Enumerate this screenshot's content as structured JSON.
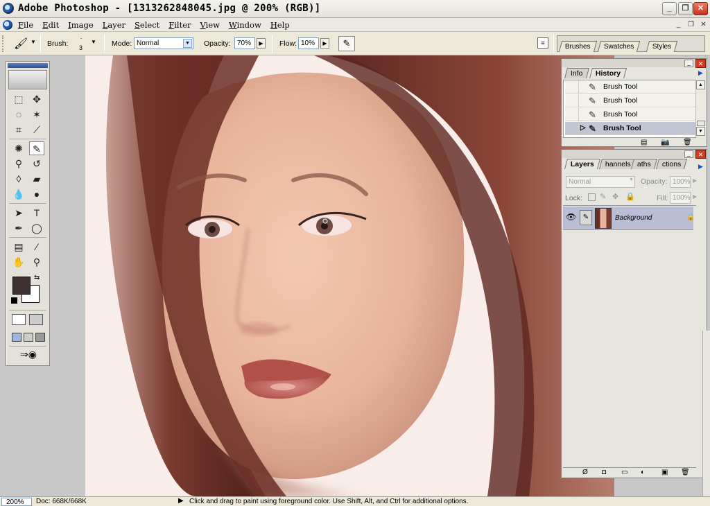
{
  "window": {
    "title": "Adobe Photoshop - [1313262848045.jpg @ 200% (RGB)]",
    "controls": {
      "minimize": "_",
      "maximize": "❐",
      "close": "✕"
    }
  },
  "menu": [
    "File",
    "Edit",
    "Image",
    "Layer",
    "Select",
    "Filter",
    "View",
    "Window",
    "Help"
  ],
  "options_bar": {
    "brush_label": "Brush:",
    "brush_size": "3",
    "mode_label": "Mode:",
    "mode_value": "Normal",
    "opacity_label": "Opacity:",
    "opacity_value": "70%",
    "flow_label": "Flow:",
    "flow_value": "10%"
  },
  "palette_well": {
    "tabs": [
      "Brushes",
      "Swatches",
      "Styles"
    ]
  },
  "history_panel": {
    "tabs": [
      "Info",
      "History"
    ],
    "active_tab": "History",
    "items": [
      {
        "label": "Brush Tool"
      },
      {
        "label": "Brush Tool"
      },
      {
        "label": "Brush Tool"
      },
      {
        "label": "Brush Tool",
        "current": true
      }
    ]
  },
  "layers_panel": {
    "tabs": [
      "Layers",
      "Channels",
      "Paths",
      "Actions"
    ],
    "tab_display": [
      "Layers",
      "hannels",
      "aths",
      "ctions"
    ],
    "active_tab": "Layers",
    "blend_mode": "Normal",
    "opacity_label": "Opacity:",
    "opacity_value": "100%",
    "lock_label": "Lock:",
    "fill_label": "Fill:",
    "fill_value": "100%",
    "layers": [
      {
        "name": "Background",
        "visible": true,
        "locked": true
      }
    ]
  },
  "colors": {
    "foreground": "#3e3030",
    "background": "#ffffff"
  },
  "status": {
    "zoom": "200%",
    "doc_info": "Doc: 668K/668K",
    "hint": "Click and drag to paint using foreground color.  Use Shift, Alt, and Ctrl for additional options."
  }
}
